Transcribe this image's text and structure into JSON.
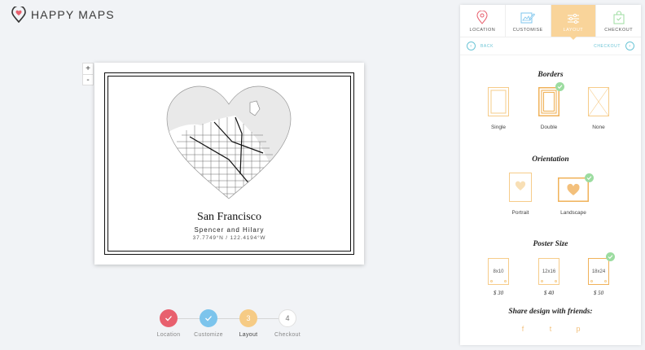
{
  "brand": {
    "name": "HAPPY MAPS"
  },
  "zoom": {
    "in": "+",
    "out": "-"
  },
  "poster": {
    "title": "San Francisco",
    "subtitle": "Spencer and Hilary",
    "coords": "37.7749°N / 122.4194°W"
  },
  "steps": [
    {
      "label": "Location",
      "state": "done",
      "color": "#e8606e"
    },
    {
      "label": "Customize",
      "state": "done",
      "color": "#7cc4ec"
    },
    {
      "label": "Layout",
      "state": "active",
      "number": "3",
      "color": "#f6cb85"
    },
    {
      "label": "Checkout",
      "state": "todo",
      "number": "4"
    }
  ],
  "tabs": [
    {
      "label": "LOCATION"
    },
    {
      "label": "CUSTOMISE"
    },
    {
      "label": "LAYOUT"
    },
    {
      "label": "CHECKOUT"
    }
  ],
  "nav": {
    "back": "BACK",
    "next": "CHECKOUT",
    "back_arrow": "‹",
    "next_arrow": "›"
  },
  "borders": {
    "title": "Borders",
    "options": [
      {
        "label": "Single"
      },
      {
        "label": "Double",
        "selected": true
      },
      {
        "label": "None"
      }
    ]
  },
  "orientation": {
    "title": "Orientation",
    "options": [
      {
        "label": "Portrait"
      },
      {
        "label": "Landscape",
        "selected": true
      }
    ]
  },
  "poster_size": {
    "title": "Poster Size",
    "options": [
      {
        "size": "8x10",
        "price": "$ 30"
      },
      {
        "size": "12x16",
        "price": "$ 40"
      },
      {
        "size": "18x24",
        "price": "$ 50",
        "selected": true
      }
    ]
  },
  "share": {
    "title": "Share design with friends:",
    "icons": [
      "facebook-icon",
      "twitter-icon",
      "pinterest-icon"
    ],
    "glyphs": [
      "f",
      "t",
      "p"
    ]
  },
  "colors": {
    "accent": "#f9d49a",
    "accent_dark": "#f0b25a",
    "teal": "#6cc5d6",
    "check": "#9cdca0",
    "location_red": "#e8606e",
    "customize_blue": "#7cc4ec"
  }
}
